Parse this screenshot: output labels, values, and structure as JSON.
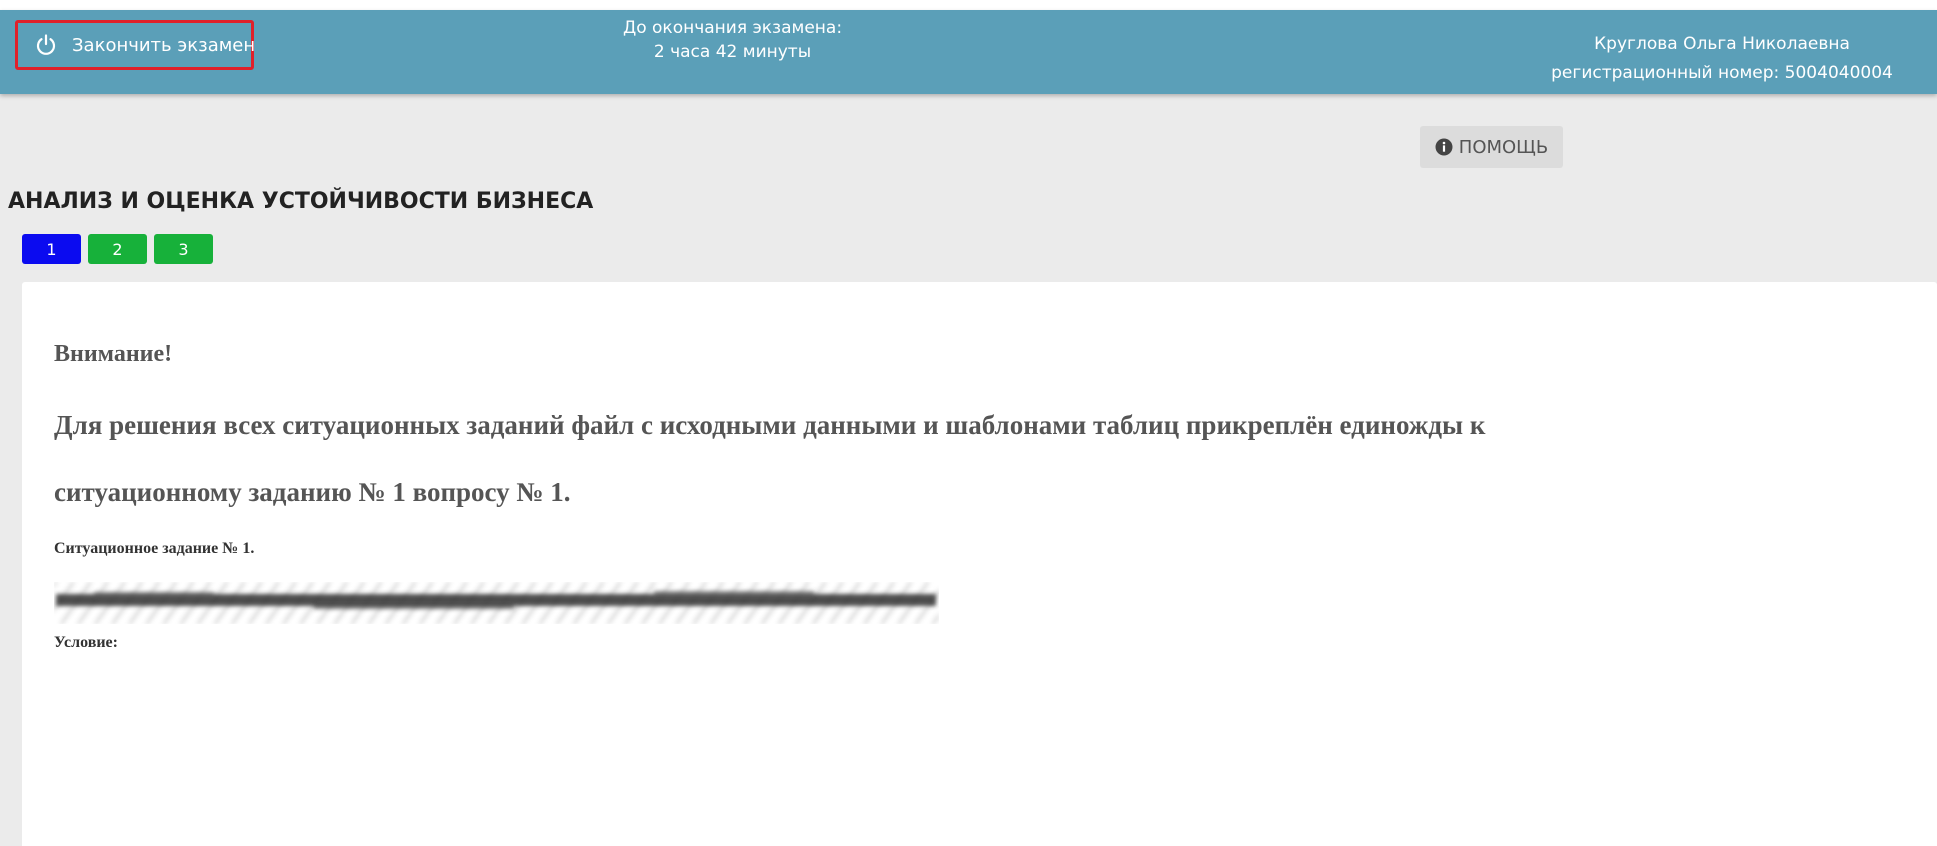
{
  "header": {
    "finish_button_label": "Закончить экзамен",
    "timer_label": "До окончания экзамена:",
    "timer_value": "2 часа 42 минуты",
    "user_name": "Круглова Ольга Николаевна",
    "registration": "регистрационный номер: 5004040004",
    "background_color": "#5b9fb8",
    "finish_border_color": "#e0202a"
  },
  "help_button_label": "ПОМОЩЬ",
  "section_title": "АНАЛИЗ И ОЦЕНКА УСТОЙЧИВОСТИ БИЗНЕСА",
  "tabs": [
    {
      "label": "1",
      "color": "#0b0bf0",
      "state": "active"
    },
    {
      "label": "2",
      "color": "#17b13a",
      "state": "answered"
    },
    {
      "label": "3",
      "color": "#17b13a",
      "state": "answered"
    }
  ],
  "content": {
    "attention": "Внимание!",
    "instruction": "Для решения всех ситуационных заданий файл с исходными данными и шаблонами таблиц прикреплён единожды к ситуационному заданию № 1 вопросу № 1.",
    "task_label": "Ситуационное задание № 1.",
    "condition_label": "Условие:"
  },
  "icons": {
    "finish": "power-icon",
    "help": "info-circle-icon"
  }
}
